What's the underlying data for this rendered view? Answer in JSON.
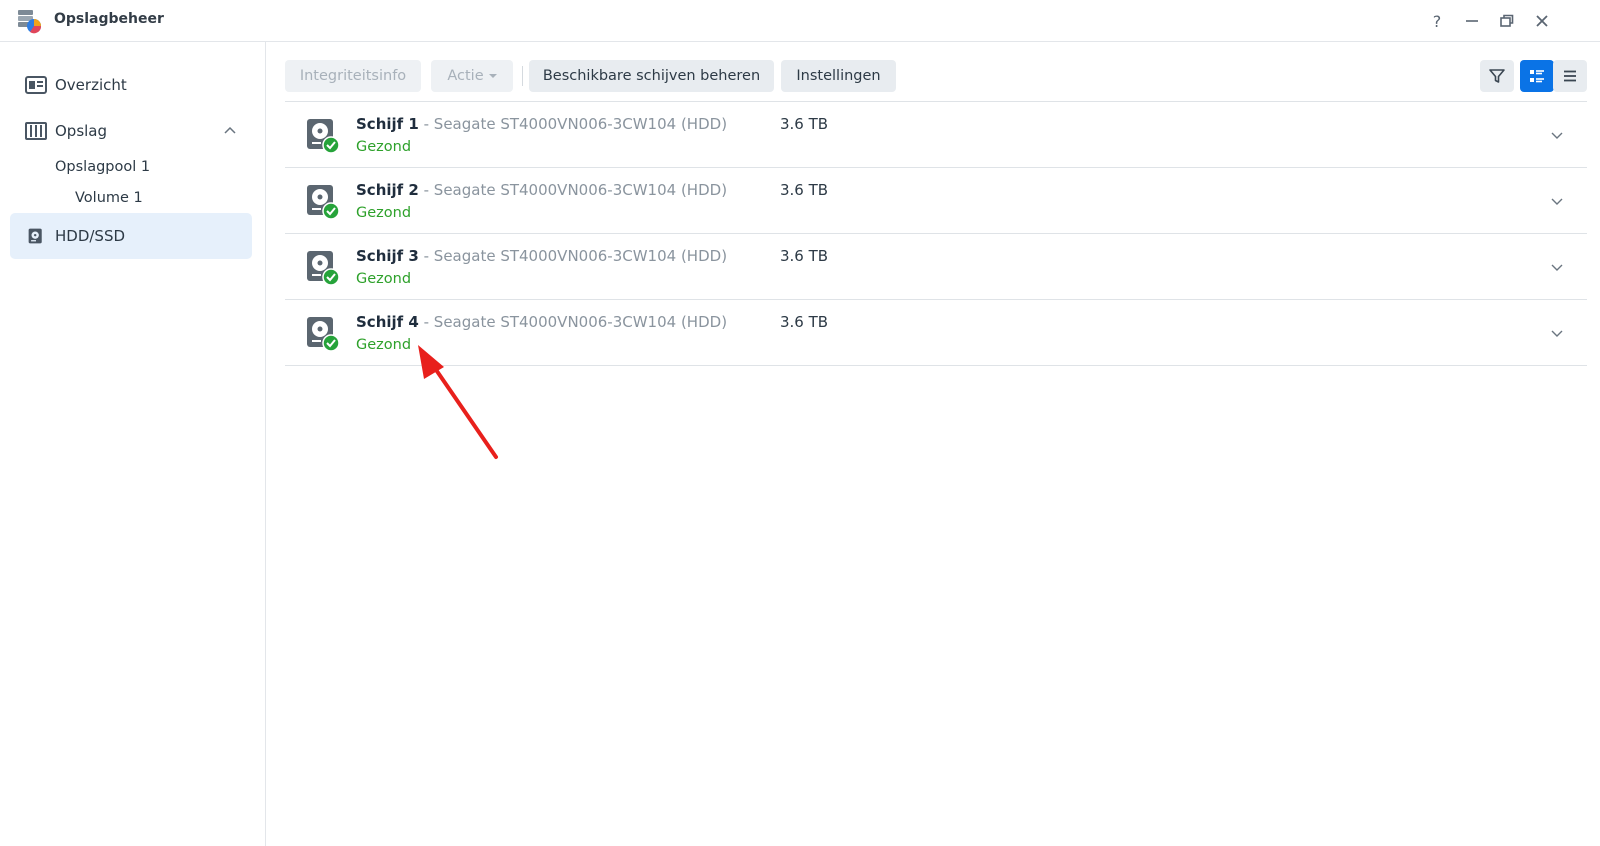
{
  "window": {
    "title": "Opslagbeheer",
    "controls": [
      "help-icon",
      "minimize-icon",
      "restore-icon",
      "close-icon"
    ]
  },
  "sidebar": {
    "items": [
      {
        "label": "Overzicht",
        "icon": "overview-icon"
      },
      {
        "label": "Opslag",
        "icon": "storage-icon",
        "expanded": true
      },
      {
        "label": "Opslagpool 1"
      },
      {
        "label": "Volume 1"
      },
      {
        "label": "HDD/SSD",
        "icon": "hdd-icon",
        "active": true
      }
    ]
  },
  "toolbar": {
    "integrity_label": "Integriteitsinfo",
    "action_label": "Actie",
    "manage_label": "Beschikbare schijven beheren",
    "settings_label": "Instellingen",
    "view_mode": "list-detail"
  },
  "disks": [
    {
      "name": "Schijf 1",
      "model": " - Seagate ST4000VN006-3CW104 (HDD)",
      "size": "3.6 TB",
      "status": "Gezond"
    },
    {
      "name": "Schijf 2",
      "model": " - Seagate ST4000VN006-3CW104 (HDD)",
      "size": "3.6 TB",
      "status": "Gezond"
    },
    {
      "name": "Schijf 3",
      "model": " - Seagate ST4000VN006-3CW104 (HDD)",
      "size": "3.6 TB",
      "status": "Gezond"
    },
    {
      "name": "Schijf 4",
      "model": " - Seagate ST4000VN006-3CW104 (HDD)",
      "size": "3.6 TB",
      "status": "Gezond"
    }
  ],
  "colors": {
    "accent": "#0a73e6",
    "healthy": "#2ea12b",
    "annotation_arrow": "#e8201c"
  }
}
